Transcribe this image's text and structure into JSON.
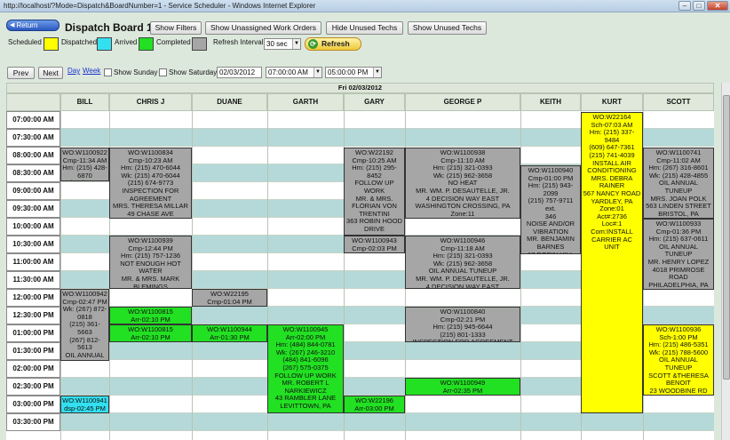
{
  "window": {
    "title": "http://localhost/?Mode=Dispatch&BoardNumber=1 - Service Scheduler - Windows Internet Explorer"
  },
  "toolbar": {
    "return_label": "Return",
    "page_title": "Dispatch Board 1",
    "show_filters": "Show Filters",
    "show_unassigned": "Show Unassigned Work Orders",
    "hide_unused": "Hide Unused Techs",
    "show_unused": "Show Unused Techs"
  },
  "legend": {
    "scheduled": "Scheduled",
    "dispatched": "Dispatched",
    "arrived": "Arrived",
    "completed": "Completed",
    "refresh_interval_label": "Refresh Interval",
    "refresh_interval_value": "30 sec",
    "refresh_label": "Refresh",
    "colors": {
      "scheduled": "#ffff00",
      "dispatched": "#33e0f0",
      "arrived": "#22e022",
      "completed": "#a6a6a6"
    }
  },
  "nav": {
    "prev": "Prev",
    "next": "Next",
    "day": "Day",
    "week": "Week",
    "show_sunday": "Show Sunday",
    "show_saturday": "Show Saturday",
    "date": "02/03/2012",
    "start_time": "07:00:00 AM",
    "end_time": "05:00:00 PM"
  },
  "schedule": {
    "date_header": "Fri 02/03/2012",
    "techs": [
      "BILL",
      "CHRIS J",
      "DUANE",
      "GARTH",
      "GARY",
      "GEORGE P",
      "KEITH",
      "KURT",
      "SCOTT"
    ],
    "times": [
      "07:00:00 AM",
      "07:30:00 AM",
      "08:00:00 AM",
      "08:30:00 AM",
      "09:00:00 AM",
      "09:30:00 AM",
      "10:00:00 AM",
      "10:30:00 AM",
      "11:00:00 AM",
      "11:30:00 AM",
      "12:00:00 PM",
      "12:30:00 PM",
      "01:00:00 PM",
      "01:30:00 PM",
      "02:00:00 PM",
      "02:30:00 PM",
      "03:00:00 PM",
      "03:30:00 PM"
    ],
    "blocks": [
      {
        "tech": "BILL",
        "status": "completed",
        "text": "WO:W1100922\nCmp-11:34 AM\nHm: (215) 428-\n6870\n(215) 638-2085"
      },
      {
        "tech": "BILL",
        "status": "completed",
        "text": "WO:W1100942\nCmp-02:47 PM\nWk: (267) 872-\n0818\n(215) 361-5663\n(267) 812-5613\nOIL ANNUAL\nTUNEUP\nMR. RICHARD"
      },
      {
        "tech": "BILL",
        "status": "dispatched",
        "text": "WO:W1100941\ndsp-02:45 PM"
      },
      {
        "tech": "CHRIS J",
        "status": "completed",
        "text": "WO:W1100834\nCmp-10:23 AM\nHm: (215) 470-6044\nWk: (215) 470-6044\n(215) 674-9773\nINSPECTION FOR\nAGREEMENT\nMRS. THERESA MILLAR\n49 CHASE AVE"
      },
      {
        "tech": "CHRIS J",
        "status": "completed",
        "text": "WO:W1100939\nCmp-12:44 PM\nHm: (215) 757-1236\nNOT ENOUGH HOT\nWATER\nMR. & MRS. MARK\nBLEMINGS"
      },
      {
        "tech": "CHRIS J",
        "status": "arrived",
        "text": "WO:W1100815\nArr-02:10 PM"
      },
      {
        "tech": "CHRIS J",
        "status": "arrived",
        "text": "WO:W1100815\nArr-02:10 PM"
      },
      {
        "tech": "DUANE",
        "status": "completed",
        "text": "WO:W22195\nCmp-01:04 PM"
      },
      {
        "tech": "DUANE",
        "status": "arrived",
        "text": "WO:W1100944\nArr-01:30 PM"
      },
      {
        "tech": "GARTH",
        "status": "arrived",
        "text": "WO:W1100945\nArr-02:00 PM\nHm: (484) 844-0781\nWk: (267) 246-3210\n(484) 841-6096\n(267) 575-0375\nFOLLOW UP WORK\nMR. ROBERT L\nNARKIEWICZ\n43 RAMBLER LANE\nLEVITTOWN, PA"
      },
      {
        "tech": "GARY",
        "status": "completed",
        "text": "WO:W22192\nCmp-10:25 AM\nHm: (215) 295-8452\nFOLLOW UP\nWORK\nMR. & MRS.\nFLORIAN VON\nTRENTINI\n363 ROBIN HOOD\nDRIVE\nYARDLEY, PA"
      },
      {
        "tech": "GARY",
        "status": "completed",
        "text": "WO:W1100943\nCmp-02:03 PM"
      },
      {
        "tech": "GARY",
        "status": "arrived",
        "text": "WO:W22196\nArr-03:00 PM"
      },
      {
        "tech": "GEORGE P",
        "status": "completed",
        "text": "WO:W1100938\nCmp-11:10 AM\nHm: (215) 321-0393\nWk: (215) 962-3658\nNO HEAT\nMR. WM. P. DESAUTELLE, JR.\n4 DECISION WAY EAST\nWASHINGTON CROSSING, PA\nZone:11"
      },
      {
        "tech": "GEORGE P",
        "status": "completed",
        "text": "WO:W1100946\nCmp-11:18 AM\nHm: (215) 321-0393\nWk: (215) 962-3658\nOIL ANNUAL TUNEUP\nMR. WM. P. DESAUTELLE, JR.\n4 DECISION WAY EAST"
      },
      {
        "tech": "GEORGE P",
        "status": "completed",
        "text": "WO:W1100840\nCmp-02:21 PM\nHm: (215) 945-6644\n(215) 801-1333\nINSPECTION FOR AGREEMENT"
      },
      {
        "tech": "GEORGE P",
        "status": "arrived",
        "text": "WO:W1100949\nArr-02:35 PM"
      },
      {
        "tech": "KEITH",
        "status": "completed",
        "text": "WO:W1100940\nCmp-01:00 PM\nHm: (215) 943-2099\n(215) 757-9711 ext.\n346\nNOISE AND/OR\nVIBRATION\nMR. BENJAMIN\nBARNES\n17 ROBIN HILL\nLANE\nLEVITTOWN, PA"
      },
      {
        "tech": "KURT",
        "status": "scheduled",
        "text": "WO:W22164\nSch-07:03 AM\nHm: (215) 337-\n9484\n(609) 647-7361\n(215) 741-4039\nINSTALL AIR\nCONDITIONING\nMRS. DEBRA\nRAINER\n567 NANCY ROAD\nYARDLEY, PA\nZone:01\nAct#:2736\nLoc#:1\nCom:INSTALL\nCARRIER AC\nUNIT"
      },
      {
        "tech": "SCOTT",
        "status": "completed",
        "text": "WO:W1100741\nCmp-11:02 AM\nHm: (267) 316-8601\nWk: (215) 428-4855\nOIL ANNUAL TUNEUP\nMRS. JOAN POLK\n563 LINDEN STREET\nBRISTOL, PA\nZone:15"
      },
      {
        "tech": "SCOTT",
        "status": "completed",
        "text": "WO:W1100933\nCmp-01:36 PM\nHm: (215) 637-0611\nOIL ANNUAL TUNEUP\nMR. HENRY LOPEZ\n4018 PRIMROSE\nROAD\nPHILADELPHIA, PA\nZone:21"
      },
      {
        "tech": "SCOTT",
        "status": "scheduled",
        "text": "WO:W1100936\nSch-1:00 PM\nHm: (215) 486-5351\nWk: (215) 788-5600\nOIL ANNUAL TUNEUP\nSCOTT &THERESA\nBENOIT\n23 WOODBINE RD\nLEVITTOWN, PA"
      }
    ]
  }
}
